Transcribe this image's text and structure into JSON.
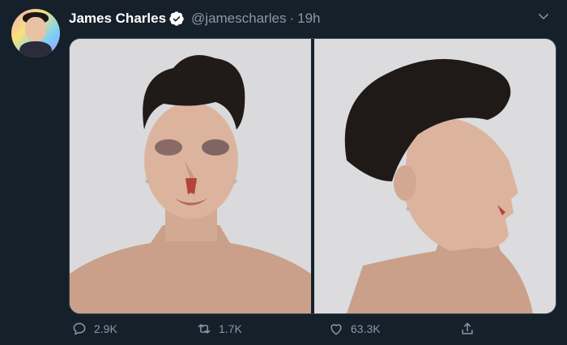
{
  "tweet": {
    "author_name": "James Charles",
    "handle": "@jamescharles",
    "separator": "·",
    "time": "19h",
    "verified": true
  },
  "actions": {
    "reply_count": "2.9K",
    "retweet_count": "1.7K",
    "like_count": "63.3K"
  },
  "colors": {
    "background": "#15202b",
    "secondary_text": "#8899a6",
    "verified_badge": "#1da1f2"
  },
  "icons": [
    "verified-icon",
    "chevron-down-icon",
    "reply-icon",
    "retweet-icon",
    "like-icon",
    "share-icon"
  ]
}
